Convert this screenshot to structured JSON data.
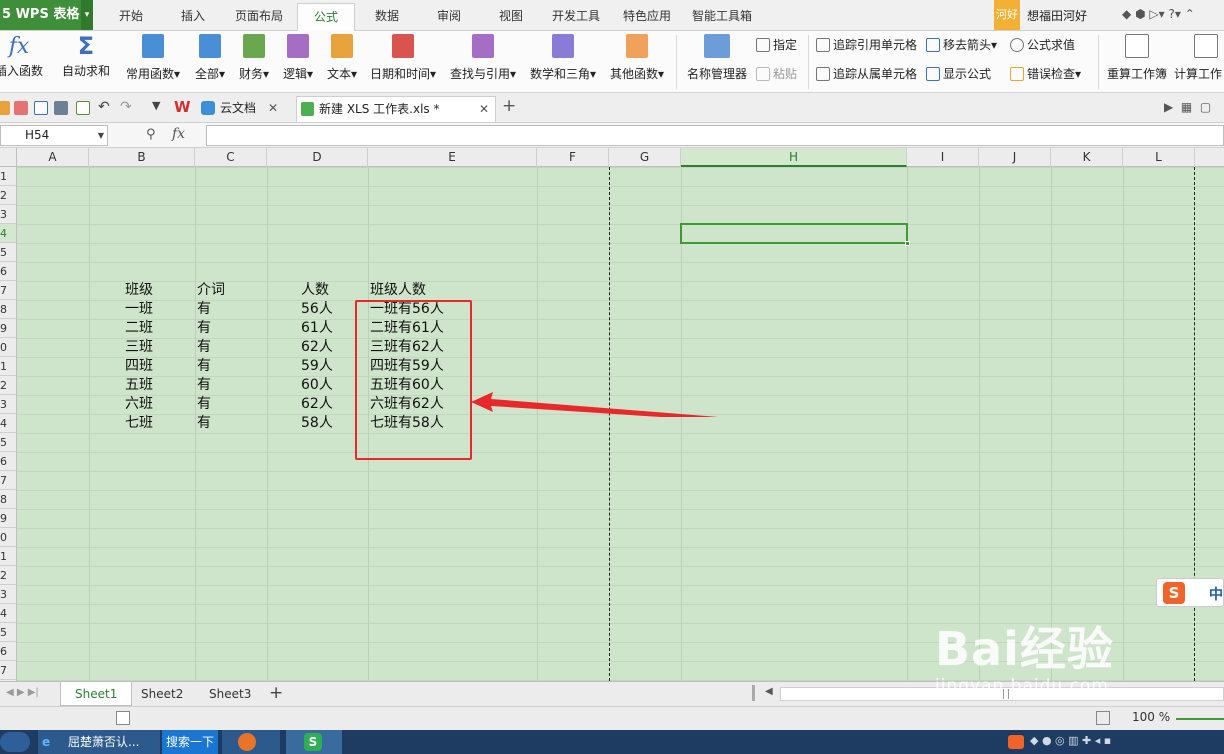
{
  "app": {
    "name": "WPS 表格",
    "badge": "5"
  },
  "menu": {
    "tabs": [
      "开始",
      "插入",
      "页面布局",
      "公式",
      "数据",
      "审阅",
      "视图",
      "开发工具",
      "特色应用",
      "智能工具箱"
    ],
    "active": "公式"
  },
  "user": {
    "badge": "河好",
    "name": "想福田河好"
  },
  "ribbon": {
    "insert_fn": "插入函数",
    "autosum": "自动求和",
    "common": "常用函数",
    "all": "全部",
    "finance": "财务",
    "logic": "逻辑",
    "text": "文本",
    "datetime": "日期和时间",
    "lookup": "查找与引用",
    "math": "数学和三角",
    "other": "其他函数",
    "name_mgr": "名称管理器",
    "assign": "指定",
    "paste": "粘贴",
    "trace_prec": "追踪引用单元格",
    "trace_dep": "追踪从属单元格",
    "remove_arrows": "移去箭头",
    "show_formula": "显示公式",
    "eval_formula": "公式求值",
    "error_check": "错误检查",
    "recalc_book": "重算工作簿",
    "calc_sheet": "计算工作"
  },
  "tabs": {
    "cloud": "云文档",
    "file": "新建 XLS 工作表.xls *"
  },
  "formula_bar": {
    "name_box": "H54",
    "fx": "fx",
    "formula": ""
  },
  "columns": [
    "A",
    "B",
    "C",
    "D",
    "E",
    "F",
    "G",
    "H",
    "I",
    "J",
    "K",
    "L"
  ],
  "selected_column": "H",
  "rows": [
    "1",
    "2",
    "3",
    "4",
    "5",
    "6",
    "7",
    "8",
    "9",
    "0",
    "1",
    "2",
    "3",
    "4",
    "5",
    "6",
    "7",
    "8",
    "9",
    "0",
    "1",
    "2",
    "3",
    "4",
    "5",
    "6",
    "7"
  ],
  "selected_row_index": 3,
  "table": {
    "headers": [
      "班级",
      "介词",
      "人数",
      "班级人数"
    ],
    "rows": [
      [
        "一班",
        "有",
        "56人",
        "一班有56人"
      ],
      [
        "二班",
        "有",
        "61人",
        "二班有61人"
      ],
      [
        "三班",
        "有",
        "62人",
        "三班有62人"
      ],
      [
        "四班",
        "有",
        "59人",
        "四班有59人"
      ],
      [
        "五班",
        "有",
        "60人",
        "五班有60人"
      ],
      [
        "六班",
        "有",
        "62人",
        "六班有62人"
      ],
      [
        "七班",
        "有",
        "58人",
        "七班有58人"
      ]
    ]
  },
  "sheets": [
    "Sheet1",
    "Sheet2",
    "Sheet3"
  ],
  "active_sheet": "Sheet1",
  "status": {
    "zoom": "100 %"
  },
  "taskbar": {
    "ie_item": "屈楚萧否认...",
    "search": "搜索一下"
  },
  "watermark": {
    "logo": "Bai经验",
    "url": "jingyan.baidu.com"
  },
  "ime": {
    "label": "中"
  },
  "colors": {
    "accent": "#3f8f3a",
    "highlight": "#e8282a",
    "cell_bg": "#cfe5cb"
  }
}
